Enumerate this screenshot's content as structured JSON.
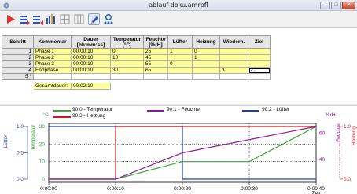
{
  "window": {
    "title": "ablauf-doku.amrpfl",
    "min_glyph": "–",
    "max_glyph": "□",
    "close_glyph": "✕"
  },
  "toolbar": {
    "buttons": [
      {
        "name": "run-icon",
        "color": "#e03030"
      },
      {
        "name": "insert-rows-icon",
        "color": "#3050c0"
      },
      {
        "name": "delete-rows-icon",
        "color": "#3050c0"
      },
      {
        "name": "chart-bars-icon",
        "color": "#3050c0"
      },
      {
        "name": "grid-disabled-icon",
        "color": "#a0a0a0"
      },
      {
        "name": "grid-disabled-2-icon",
        "color": "#a0a0a0"
      },
      {
        "name": "edit-pencil-icon",
        "color": "#3050c0"
      },
      {
        "name": "search-people-icon",
        "color": "#2060c0"
      }
    ]
  },
  "table": {
    "headers": {
      "schritt": "Schritt",
      "kommentar": "Kommentar",
      "dauer": "Dauer",
      "dauer_unit": "[hh:mm:ss]",
      "temperatur": "Temperatur",
      "temperatur_unit": "[°C]",
      "feuchte": "Feuchte",
      "feuchte_unit": "[%rH]",
      "luefter": "Lüfter",
      "heizung": "Heizung",
      "wiederh": "Wiederh.",
      "ziel": "Ziel"
    },
    "rows": [
      {
        "n": "1",
        "kommentar": "Phase 1",
        "dauer": "00:00:10",
        "temperatur": "0",
        "feuchte": "25",
        "luefter": "1",
        "heizung": "0",
        "wiederh": "",
        "ziel": ""
      },
      {
        "n": "2",
        "kommentar": "Phase 2",
        "dauer": "00:00:10",
        "temperatur": "10",
        "feuchte": "45",
        "luefter": "",
        "heizung": "1",
        "wiederh": "",
        "ziel": ""
      },
      {
        "n": "3",
        "kommentar": "Phase 3",
        "dauer": "00:00:10",
        "temperatur": "",
        "feuchte": "55",
        "luefter": "0",
        "heizung": "",
        "wiederh": "",
        "ziel": ""
      },
      {
        "n": "4",
        "kommentar": "Endphase",
        "dauer": "00:00:10",
        "temperatur": "30",
        "feuchte": "65",
        "luefter": "",
        "heizung": "",
        "wiederh": "3",
        "ziel": "2"
      }
    ],
    "new_row_marker": "5 *",
    "total_label": "Gesamtdauer:",
    "total_value": "00:02:10"
  },
  "colors": {
    "temperatur": "#38a838",
    "feuchte": "#8a1a9a",
    "luefter": "#2040b0",
    "heizung": "#d01818"
  },
  "chart_data": {
    "type": "line",
    "legend": [
      "90.0 - Temperatur",
      "90.1 - Feuchte",
      "90.2 - Lüfter",
      "90.3 - Heizung"
    ],
    "xlabel": "Zeit",
    "x_ticks": [
      "0:00:00",
      "0:00:10",
      "0:00:20",
      "0:00:30",
      "0:00:40"
    ],
    "left_axis_1": {
      "label": "Lüfter",
      "ticks": [
        "0.0",
        "0.5",
        "1.0"
      ],
      "range": [
        0,
        1
      ]
    },
    "left_axis_2": {
      "label": "Temperatur",
      "unit": "°C",
      "ticks": [
        "0",
        "10",
        "20",
        "30"
      ],
      "range": [
        0,
        30
      ]
    },
    "right_axis_1": {
      "label": "Feuchte",
      "unit": "%rH",
      "ticks": [
        "40",
        "60"
      ],
      "range": [
        25,
        65
      ]
    },
    "right_axis_2": {
      "label": "Heizung",
      "ticks": [
        "0.0",
        "1.0"
      ],
      "range": [
        0,
        1
      ]
    },
    "x_range": [
      0,
      40
    ],
    "series": [
      {
        "name": "90.0 - Temperatur",
        "x": [
          0,
          10,
          20,
          30,
          40
        ],
        "y": [
          0,
          0,
          10,
          10,
          30
        ]
      },
      {
        "name": "90.1 - Feuchte",
        "x": [
          0,
          10,
          20,
          30,
          40
        ],
        "y": [
          25,
          25,
          45,
          55,
          65
        ]
      },
      {
        "name": "90.2 - Lüfter",
        "x": [
          0,
          10,
          20,
          40
        ],
        "y": [
          1,
          1,
          0,
          0
        ]
      },
      {
        "name": "90.3 - Heizung",
        "x": [
          0,
          10,
          20,
          40
        ],
        "y": [
          0,
          1,
          1,
          1
        ]
      }
    ],
    "grid": true
  }
}
